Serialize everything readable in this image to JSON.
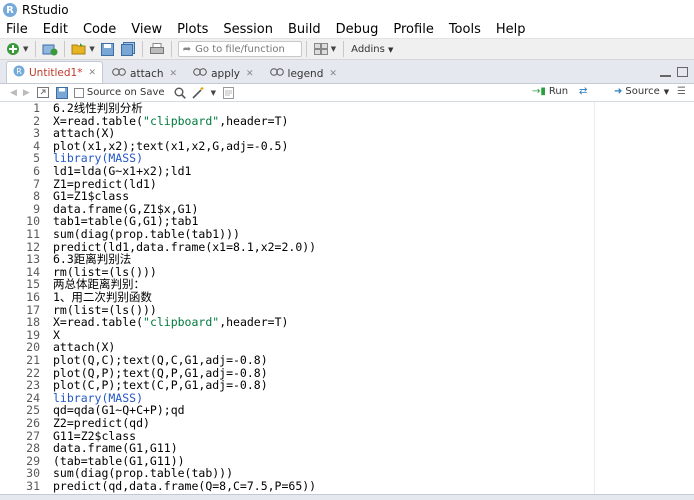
{
  "window": {
    "title": "RStudio"
  },
  "menu": [
    "File",
    "Edit",
    "Code",
    "View",
    "Plots",
    "Session",
    "Build",
    "Debug",
    "Profile",
    "Tools",
    "Help"
  ],
  "toolbar": {
    "goto_placeholder": "Go to file/function",
    "addins_label": "Addins"
  },
  "tabs": [
    {
      "label": "Untitled1*",
      "active": true,
      "icon": "r-file-icon"
    },
    {
      "label": "attach",
      "active": false,
      "icon": "view-icon"
    },
    {
      "label": "apply",
      "active": false,
      "icon": "view-icon"
    },
    {
      "label": "legend",
      "active": false,
      "icon": "view-icon"
    }
  ],
  "editor_toolbar": {
    "source_on_save": "Source on Save",
    "run": "Run",
    "source": "Source"
  },
  "code_lines": [
    {
      "n": "1",
      "text": "6.2线性判别分析"
    },
    {
      "n": "2",
      "text": "X=read.table(\"clipboard\",header=T)"
    },
    {
      "n": "3",
      "text": "attach(X)"
    },
    {
      "n": "4",
      "text": "plot(x1,x2);text(x1,x2,G,adj=-0.5)"
    },
    {
      "n": "5",
      "text": "library(MASS)"
    },
    {
      "n": "6",
      "text": "ld1=lda(G~x1+x2);ld1"
    },
    {
      "n": "7",
      "text": "Z1=predict(ld1)"
    },
    {
      "n": "8",
      "text": "G1=Z1$class"
    },
    {
      "n": "9",
      "text": "data.frame(G,Z1$x,G1)"
    },
    {
      "n": "10",
      "text": "tab1=table(G,G1);tab1"
    },
    {
      "n": "11",
      "text": "sum(diag(prop.table(tab1)))"
    },
    {
      "n": "12",
      "text": "predict(ld1,data.frame(x1=8.1,x2=2.0))"
    },
    {
      "n": "13",
      "text": "6.3距离判别法"
    },
    {
      "n": "14",
      "text": "rm(list=(ls()))"
    },
    {
      "n": "15",
      "text": "两总体距离判别："
    },
    {
      "n": "16",
      "text": "1、用二次判别函数"
    },
    {
      "n": "17",
      "text": "rm(list=(ls()))"
    },
    {
      "n": "18",
      "text": "X=read.table(\"clipboard\",header=T)"
    },
    {
      "n": "19",
      "text": "X"
    },
    {
      "n": "20",
      "text": "attach(X)"
    },
    {
      "n": "21",
      "text": "plot(Q,C);text(Q,C,G1,adj=-0.8)"
    },
    {
      "n": "22",
      "text": "plot(Q,P);text(Q,P,G1,adj=-0.8)"
    },
    {
      "n": "23",
      "text": "plot(C,P);text(C,P,G1,adj=-0.8)"
    },
    {
      "n": "24",
      "text": "library(MASS)"
    },
    {
      "n": "25",
      "text": "qd=qda(G1~Q+C+P);qd"
    },
    {
      "n": "26",
      "text": "Z2=predict(qd)"
    },
    {
      "n": "27",
      "text": "G11=Z2$class"
    },
    {
      "n": "28",
      "text": "data.frame(G1,G11)"
    },
    {
      "n": "29",
      "text": "(tab=table(G1,G11))"
    },
    {
      "n": "30",
      "text": "sum(diag(prop.table(tab)))"
    },
    {
      "n": "31",
      "text": "predict(qd,data.frame(Q=8,C=7.5,P=65))"
    }
  ]
}
